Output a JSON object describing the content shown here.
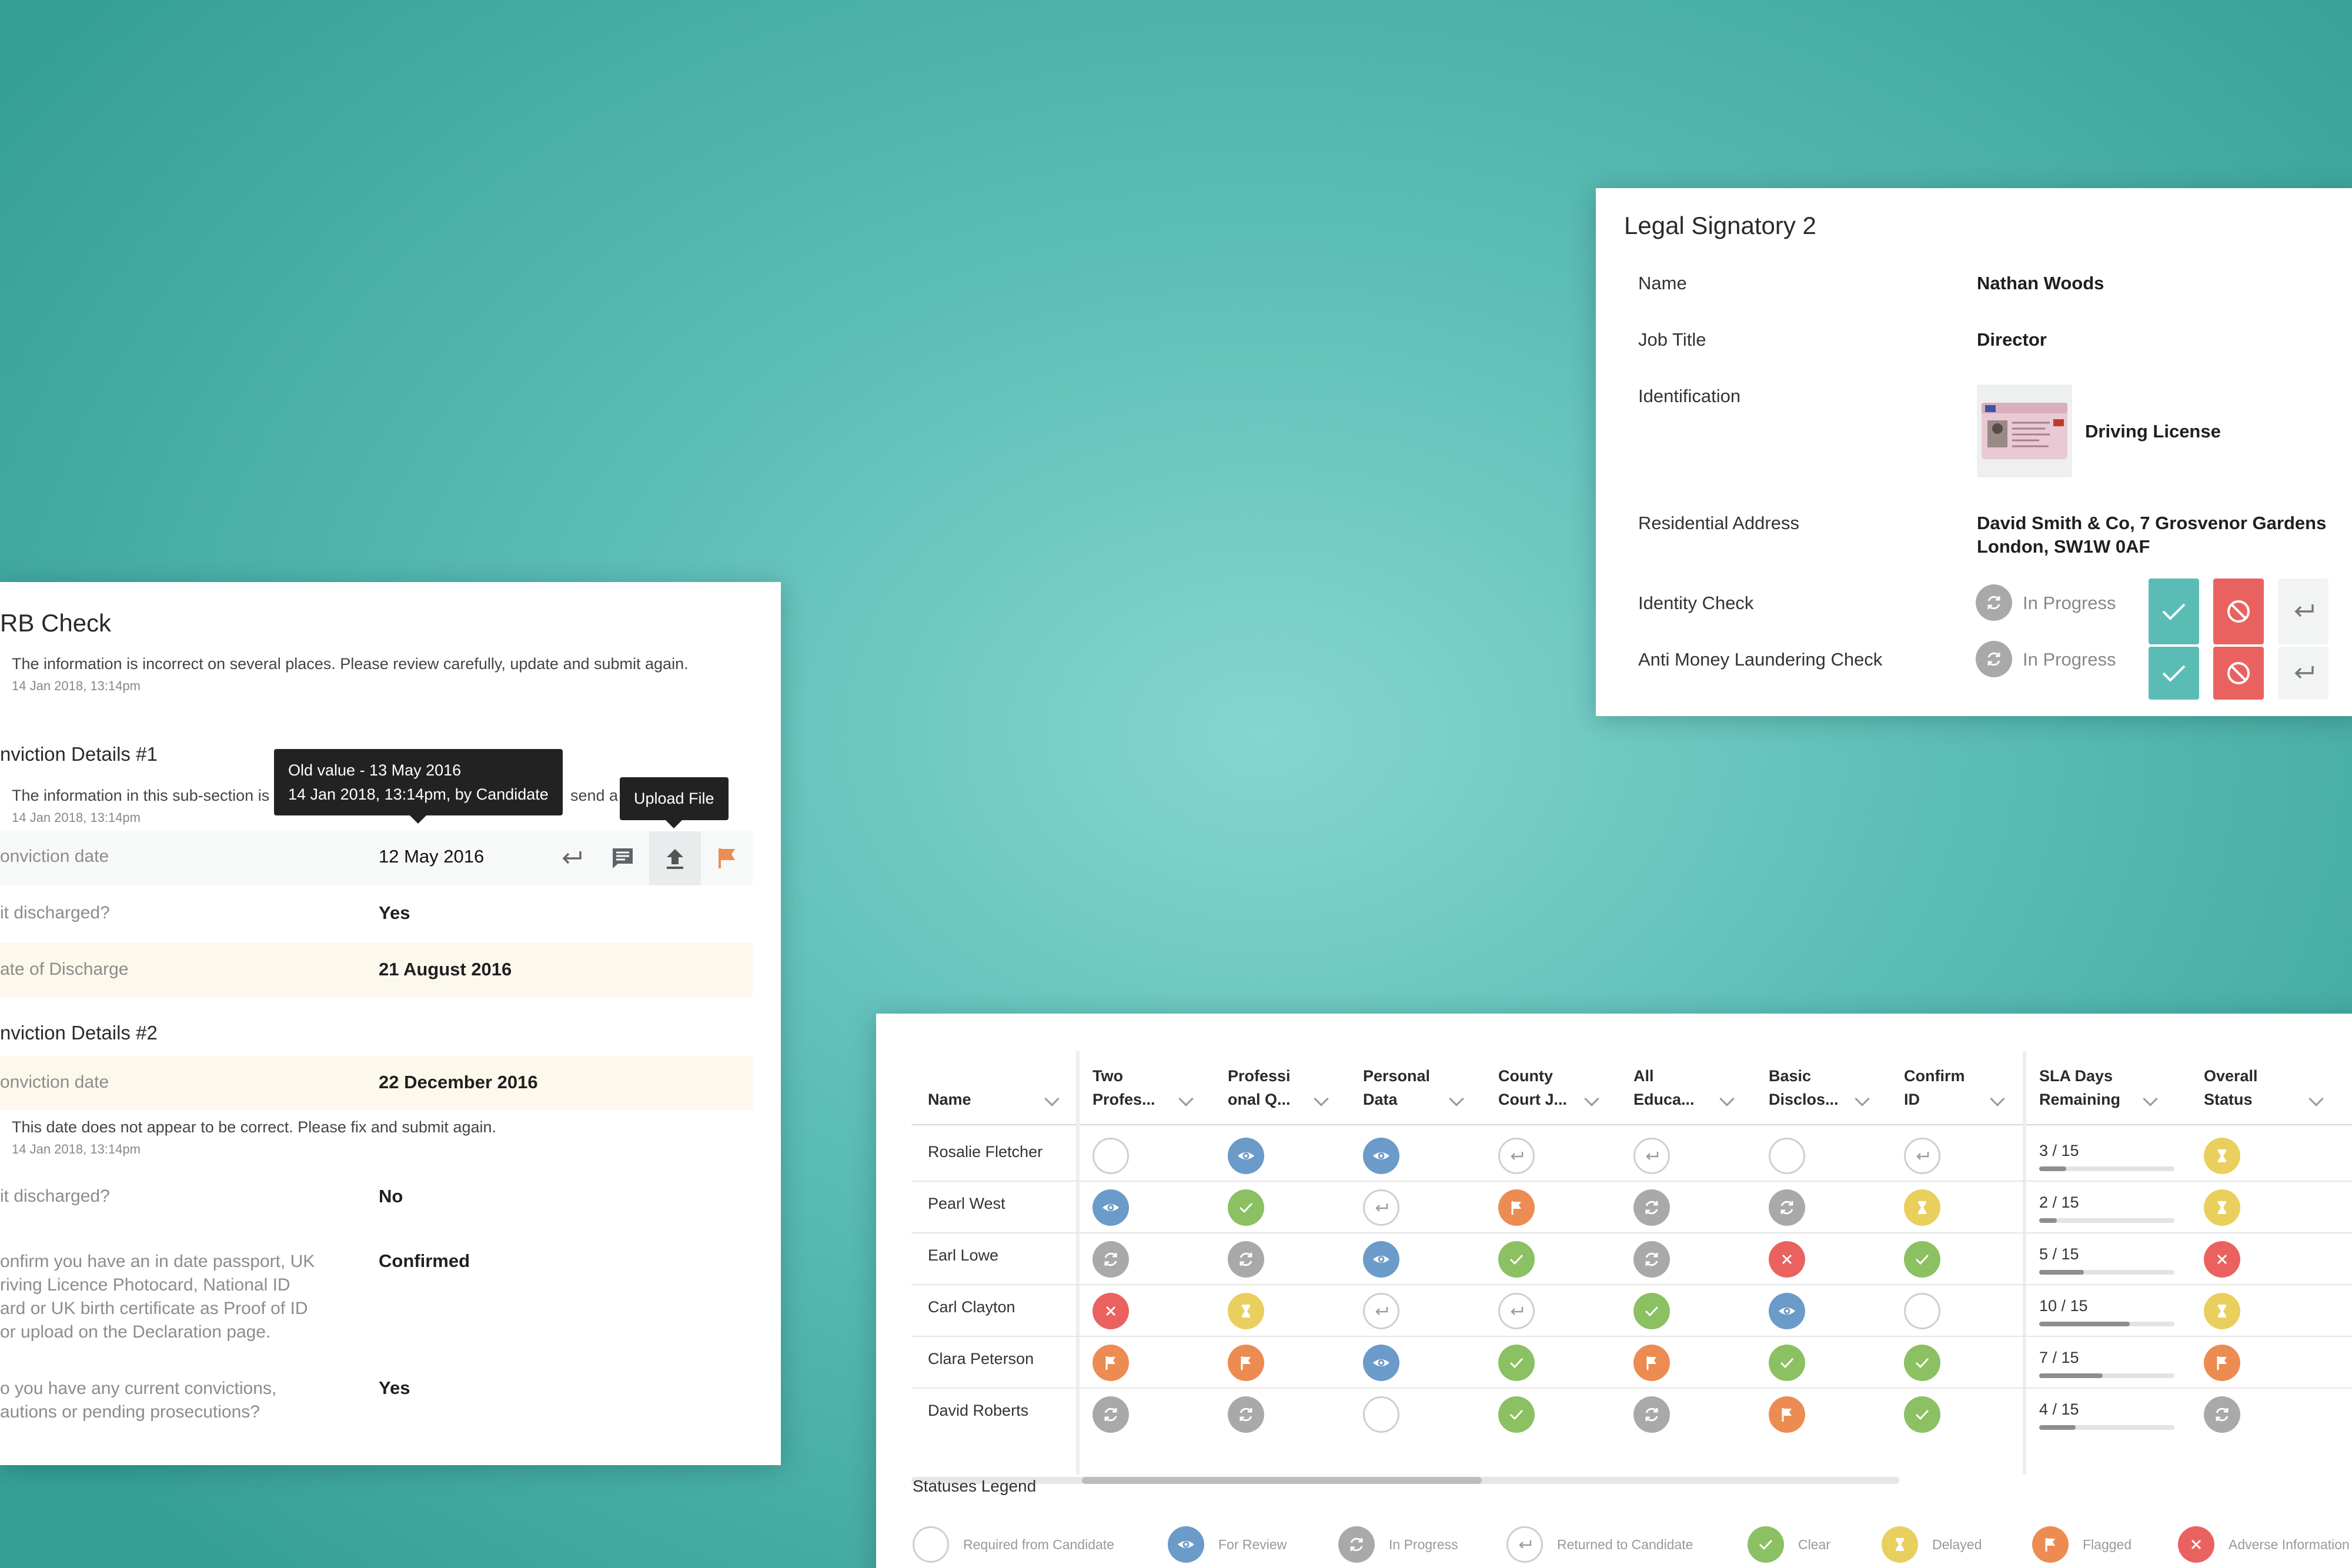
{
  "dbs": {
    "title": "RB Check",
    "note": "The information is incorrect on several places. Please review carefully, update and submit again.",
    "note_ts": "14 Jan 2018, 13:14pm",
    "section1": {
      "title": "nviction Details #1",
      "note": "The information in this sub-section is",
      "note_tail": "send a",
      "note_ts": "14 Jan 2018, 13:14pm",
      "rows": [
        {
          "label": "onviction date",
          "value": "12 May 2016"
        },
        {
          "label": "it discharged?",
          "value": "Yes"
        },
        {
          "label": "ate of Discharge",
          "value": "21 August 2016"
        }
      ]
    },
    "tooltip_old": {
      "line1": "Old value - 13 May 2016",
      "line2": "14 Jan 2018, 13:14pm, by Candidate"
    },
    "tooltip_upload": "Upload File",
    "section2": {
      "title": "nviction Details #2",
      "rows": [
        {
          "label": "onviction date",
          "value": "22 December 2016"
        }
      ],
      "note": "This date does not appear to be correct. Please fix and submit again.",
      "note_ts": "14 Jan 2018, 13:14pm",
      "rows2": [
        {
          "label": "it discharged?",
          "value": "No"
        }
      ]
    },
    "q1": {
      "lines": [
        "onfirm you have an in date passport, UK",
        "riving Licence Photocard, National ID",
        "ard or UK birth certificate as Proof of ID",
        "or upload on the Declaration page."
      ],
      "value": "Confirmed"
    },
    "q2": {
      "lines": [
        "o you have any current convictions,",
        "autions or pending prosecutions?"
      ],
      "value": "Yes"
    }
  },
  "legal": {
    "title": "Legal Signatory 2",
    "name_label": "Name",
    "name": "Nathan Woods",
    "job_label": "Job Title",
    "job": "Director",
    "id_label": "Identification",
    "id_value": "Driving License",
    "addr_label": "Residential Address",
    "addr_line1": "David Smith & Co, 7 Grosvenor Gardens",
    "addr_line2": "London, SW1W 0AF",
    "checks": [
      {
        "label": "Identity Check",
        "status": "In Progress"
      },
      {
        "label": "Anti Money Laundering Check",
        "status": "In Progress"
      }
    ]
  },
  "table": {
    "headers": [
      {
        "l1": "Name",
        "l2": ""
      },
      {
        "l1": "Two",
        "l2": "Profes..."
      },
      {
        "l1": "Professi",
        "l2": "onal Q..."
      },
      {
        "l1": "Personal",
        "l2": "Data"
      },
      {
        "l1": "County",
        "l2": "Court J..."
      },
      {
        "l1": "All",
        "l2": "Educa..."
      },
      {
        "l1": "Basic",
        "l2": "Disclos..."
      },
      {
        "l1": "Confirm",
        "l2": "ID"
      },
      {
        "l1": "SLA Days",
        "l2": "Remaining"
      },
      {
        "l1": "Overall",
        "l2": "Status"
      }
    ],
    "rows": [
      {
        "name": "Rosalie Fletcher",
        "s": [
          "required",
          "review",
          "review",
          "returned",
          "returned",
          "required",
          "returned"
        ],
        "sla": "3 / 15",
        "sla_frac": 0.2,
        "overall": "delayed"
      },
      {
        "name": "Pearl West",
        "s": [
          "review",
          "clear",
          "returned",
          "flagged",
          "progress",
          "progress",
          "delayed"
        ],
        "sla": "2 / 15",
        "sla_frac": 0.13,
        "overall": "delayed"
      },
      {
        "name": "Earl Lowe",
        "s": [
          "progress",
          "progress",
          "review",
          "clear",
          "progress",
          "adverse",
          "clear"
        ],
        "sla": "5 / 15",
        "sla_frac": 0.33,
        "overall": "adverse"
      },
      {
        "name": "Carl Clayton",
        "s": [
          "adverse",
          "delayed",
          "returned",
          "returned",
          "clear",
          "review",
          "required"
        ],
        "sla": "10 / 15",
        "sla_frac": 0.67,
        "overall": "delayed"
      },
      {
        "name": "Clara Peterson",
        "s": [
          "flagged",
          "flagged",
          "review",
          "clear",
          "flagged",
          "clear",
          "clear"
        ],
        "sla": "7 / 15",
        "sla_frac": 0.47,
        "overall": "flagged"
      },
      {
        "name": "David Roberts",
        "s": [
          "progress",
          "progress",
          "required",
          "clear",
          "progress",
          "flagged",
          "clear"
        ],
        "sla": "4 / 15",
        "sla_frac": 0.27,
        "overall": "progress"
      }
    ],
    "legend_title": "Statuses Legend",
    "legend": [
      {
        "key": "required",
        "label": "Required from Candidate"
      },
      {
        "key": "review",
        "label": "For Review"
      },
      {
        "key": "progress",
        "label": "In Progress"
      },
      {
        "key": "returned",
        "label": "Returned to Candidate"
      },
      {
        "key": "clear",
        "label": "Clear"
      },
      {
        "key": "delayed",
        "label": "Delayed"
      },
      {
        "key": "flagged",
        "label": "Flagged"
      },
      {
        "key": "adverse",
        "label": "Adverse Information"
      }
    ]
  },
  "colors": {
    "teal": "#5bbcb5",
    "review": "#6a9bc9",
    "clear": "#8bc063",
    "progress": "#a9a9a9",
    "delayed": "#e9cf5e",
    "flagged": "#ec8c52",
    "adverse": "#ea6260"
  }
}
